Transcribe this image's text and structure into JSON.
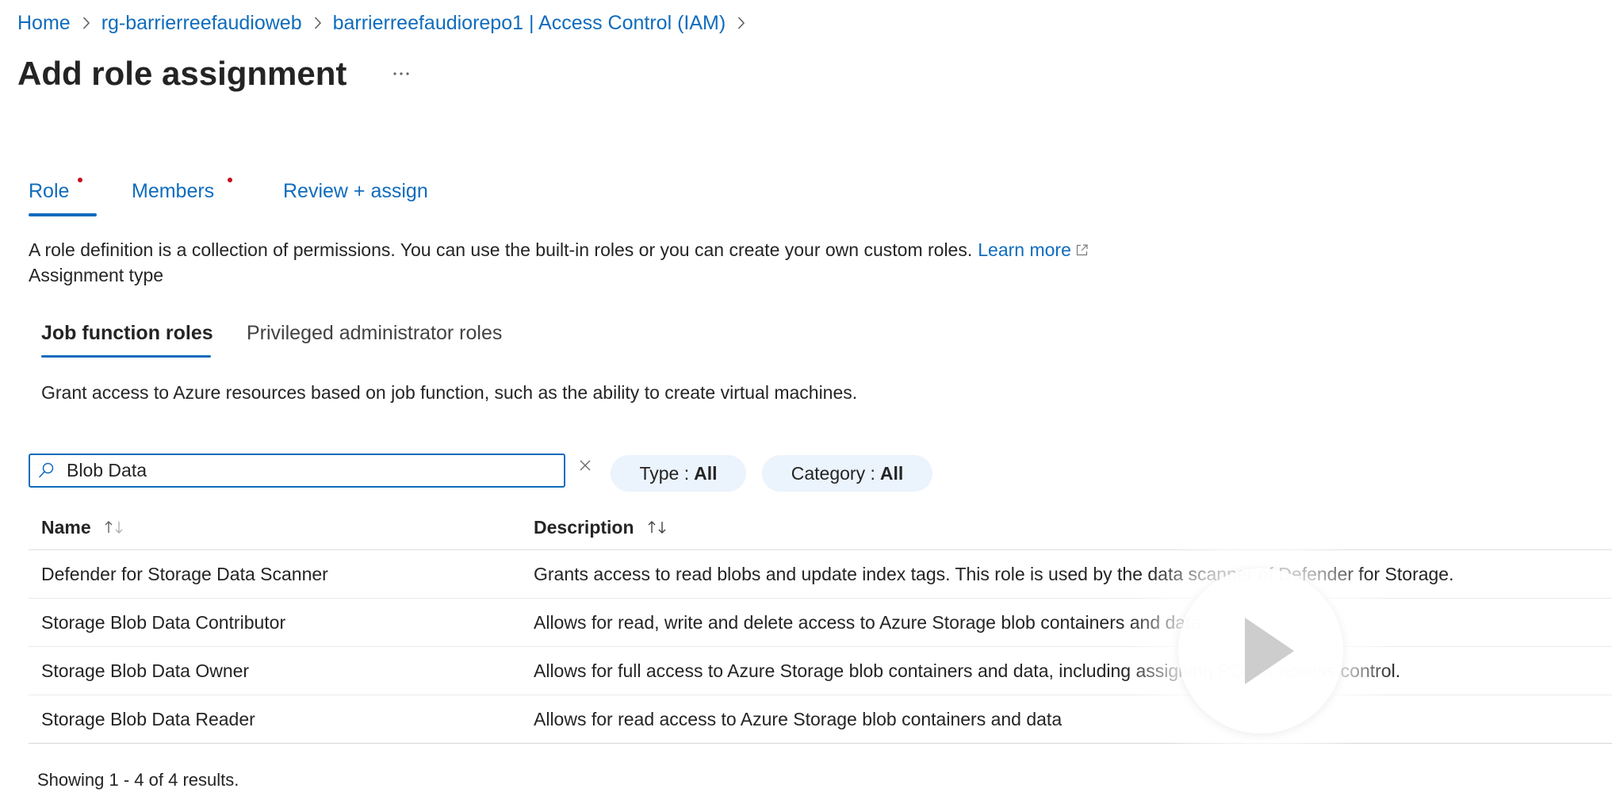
{
  "breadcrumb": {
    "items": [
      {
        "label": "Home"
      },
      {
        "label": "rg-barrierreefaudioweb"
      },
      {
        "label": "barrierreefaudiorepo1 | Access Control (IAM)"
      }
    ]
  },
  "header": {
    "title": "Add role assignment"
  },
  "tabs": [
    {
      "label": "Role",
      "required": true,
      "selected": true
    },
    {
      "label": "Members",
      "required": true,
      "selected": false
    },
    {
      "label": "Review + assign",
      "required": false,
      "selected": false
    }
  ],
  "role_tab": {
    "intro": "A role definition is a collection of permissions. You can use the built-in roles or you can create your own custom roles.",
    "learn_more": "Learn more",
    "assignment_type_label": "Assignment type",
    "assignment_tabs": [
      {
        "label": "Job function roles",
        "selected": true
      },
      {
        "label": "Privileged administrator roles",
        "selected": false
      }
    ],
    "assignment_description": "Grant access to Azure resources based on job function, such as the ability to create virtual machines.",
    "search": {
      "value": "Blob Data"
    },
    "filters": [
      {
        "label": "Type :",
        "value": "All"
      },
      {
        "label": "Category :",
        "value": "All"
      }
    ],
    "table": {
      "columns": [
        "Name",
        "Description"
      ],
      "rows": [
        {
          "name": "Defender for Storage Data Scanner",
          "description": "Grants access to read blobs and update index tags. This role is used by the data scanner of Defender for Storage."
        },
        {
          "name": "Storage Blob Data Contributor",
          "description": "Allows for read, write and delete access to Azure Storage blob containers and data"
        },
        {
          "name": "Storage Blob Data Owner",
          "description": "Allows for full access to Azure Storage blob containers and data, including assigning POSIX access control."
        },
        {
          "name": "Storage Blob Data Reader",
          "description": "Allows for read access to Azure Storage blob containers and data"
        }
      ]
    },
    "results_text": "Showing 1 - 4 of 4 results."
  },
  "icons": {
    "breadcrumb_separator": "chevron-right-icon",
    "more": "more-icon",
    "external_link": "external-link-icon",
    "search": "search-icon",
    "clear": "close-icon",
    "sort": "sort-arrows-icon",
    "video": "play-icon"
  },
  "colors": {
    "link": "#0f6cbd",
    "text": "#242424",
    "required": "#c50f1f",
    "pill_background": "#ebf3fc",
    "divider": "#e1dfdd"
  }
}
